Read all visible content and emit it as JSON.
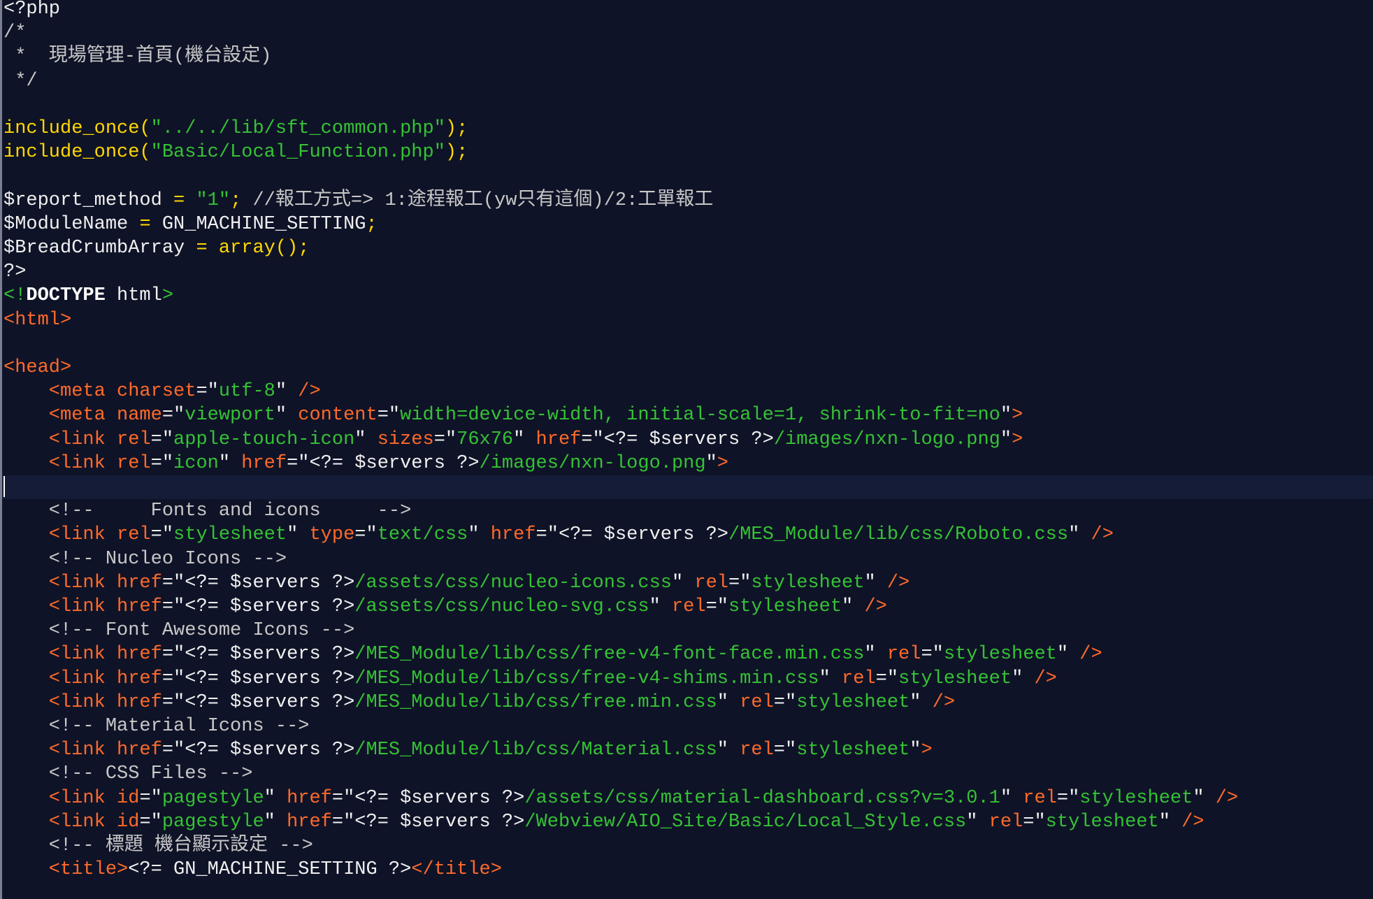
{
  "lines": [
    [
      [
        "<?php",
        "fg"
      ]
    ],
    [
      [
        "/*",
        "comment"
      ]
    ],
    [
      [
        " *  現場管理-首頁(機台設定)",
        "comment"
      ]
    ],
    [
      [
        " */",
        "comment"
      ]
    ],
    [],
    [
      [
        "include_once(",
        "func"
      ],
      [
        "\"../../lib/sft_common.php\"",
        "str"
      ],
      [
        ");",
        "func"
      ]
    ],
    [
      [
        "include_once(",
        "func"
      ],
      [
        "\"Basic/Local_Function.php\"",
        "str"
      ],
      [
        ");",
        "func"
      ]
    ],
    [],
    [
      [
        "$report_method ",
        "fg"
      ],
      [
        "= ",
        "op"
      ],
      [
        "\"1\"",
        "str"
      ],
      [
        "; ",
        "op"
      ],
      [
        "//報工方式=> 1:途程報工(yw只有這個)/2:工單報工",
        "comment"
      ]
    ],
    [
      [
        "$ModuleName ",
        "fg"
      ],
      [
        "= ",
        "op"
      ],
      [
        "GN_MACHINE_SETTING",
        "fg"
      ],
      [
        ";",
        "op"
      ]
    ],
    [
      [
        "$BreadCrumbArray ",
        "fg"
      ],
      [
        "= ",
        "op"
      ],
      [
        "array();",
        "func"
      ]
    ],
    [
      [
        "?>",
        "fg"
      ]
    ],
    [
      [
        "<!",
        "decl"
      ],
      [
        "DOCTYPE",
        "doctype"
      ],
      [
        " html",
        "fg"
      ],
      [
        ">",
        "decl"
      ]
    ],
    [
      [
        "<html>",
        "tag"
      ]
    ],
    [],
    [
      [
        "<head>",
        "tag"
      ]
    ],
    [
      [
        "    <meta ",
        "tag"
      ],
      [
        "charset",
        "attr"
      ],
      [
        "=\"",
        "quote"
      ],
      [
        "utf-8",
        "val"
      ],
      [
        "\" ",
        "quote"
      ],
      [
        "/>",
        "tag"
      ]
    ],
    [
      [
        "    <meta ",
        "tag"
      ],
      [
        "name",
        "attr"
      ],
      [
        "=\"",
        "quote"
      ],
      [
        "viewport",
        "val"
      ],
      [
        "\" ",
        "quote"
      ],
      [
        "content",
        "attr"
      ],
      [
        "=\"",
        "quote"
      ],
      [
        "width=device-width, initial-scale=1, shrink-to-fit=no",
        "val"
      ],
      [
        "\"",
        "quote"
      ],
      [
        ">",
        "tag"
      ]
    ],
    [
      [
        "    <link ",
        "tag"
      ],
      [
        "rel",
        "attr"
      ],
      [
        "=\"",
        "quote"
      ],
      [
        "apple-touch-icon",
        "val"
      ],
      [
        "\" ",
        "quote"
      ],
      [
        "sizes",
        "attr"
      ],
      [
        "=\"",
        "quote"
      ],
      [
        "76x76",
        "val"
      ],
      [
        "\" ",
        "quote"
      ],
      [
        "href",
        "attr"
      ],
      [
        "=\"<?= $servers ?>",
        "quote"
      ],
      [
        "/images/nxn-logo.png",
        "val"
      ],
      [
        "\"",
        "quote"
      ],
      [
        ">",
        "tag"
      ]
    ],
    [
      [
        "    <link ",
        "tag"
      ],
      [
        "rel",
        "attr"
      ],
      [
        "=\"",
        "quote"
      ],
      [
        "icon",
        "val"
      ],
      [
        "\" ",
        "quote"
      ],
      [
        "href",
        "attr"
      ],
      [
        "=\"<?= $servers ?>",
        "quote"
      ],
      [
        "/images/nxn-logo.png",
        "val"
      ],
      [
        "\"",
        "quote"
      ],
      [
        ">",
        "tag"
      ]
    ],
    [],
    [
      [
        "    <!--     Fonts and icons     -->",
        "comment"
      ]
    ],
    [
      [
        "    <link ",
        "tag"
      ],
      [
        "rel",
        "attr"
      ],
      [
        "=\"",
        "quote"
      ],
      [
        "stylesheet",
        "val"
      ],
      [
        "\" ",
        "quote"
      ],
      [
        "type",
        "attr"
      ],
      [
        "=\"",
        "quote"
      ],
      [
        "text/css",
        "val"
      ],
      [
        "\" ",
        "quote"
      ],
      [
        "href",
        "attr"
      ],
      [
        "=\"<?= $servers ?>",
        "quote"
      ],
      [
        "/MES_Module/lib/css/Roboto.css",
        "val"
      ],
      [
        "\" ",
        "quote"
      ],
      [
        "/>",
        "tag"
      ]
    ],
    [
      [
        "    <!-- Nucleo Icons -->",
        "comment"
      ]
    ],
    [
      [
        "    <link ",
        "tag"
      ],
      [
        "href",
        "attr"
      ],
      [
        "=\"<?= $servers ?>",
        "quote"
      ],
      [
        "/assets/css/nucleo-icons.css",
        "val"
      ],
      [
        "\" ",
        "quote"
      ],
      [
        "rel",
        "attr"
      ],
      [
        "=\"",
        "quote"
      ],
      [
        "stylesheet",
        "val"
      ],
      [
        "\" ",
        "quote"
      ],
      [
        "/>",
        "tag"
      ]
    ],
    [
      [
        "    <link ",
        "tag"
      ],
      [
        "href",
        "attr"
      ],
      [
        "=\"<?= $servers ?>",
        "quote"
      ],
      [
        "/assets/css/nucleo-svg.css",
        "val"
      ],
      [
        "\" ",
        "quote"
      ],
      [
        "rel",
        "attr"
      ],
      [
        "=\"",
        "quote"
      ],
      [
        "stylesheet",
        "val"
      ],
      [
        "\" ",
        "quote"
      ],
      [
        "/>",
        "tag"
      ]
    ],
    [
      [
        "    <!-- Font Awesome Icons -->",
        "comment"
      ]
    ],
    [
      [
        "    <link ",
        "tag"
      ],
      [
        "href",
        "attr"
      ],
      [
        "=\"<?= $servers ?>",
        "quote"
      ],
      [
        "/MES_Module/lib/css/free-v4-font-face.min.css",
        "val"
      ],
      [
        "\" ",
        "quote"
      ],
      [
        "rel",
        "attr"
      ],
      [
        "=\"",
        "quote"
      ],
      [
        "stylesheet",
        "val"
      ],
      [
        "\" ",
        "quote"
      ],
      [
        "/>",
        "tag"
      ]
    ],
    [
      [
        "    <link ",
        "tag"
      ],
      [
        "href",
        "attr"
      ],
      [
        "=\"<?= $servers ?>",
        "quote"
      ],
      [
        "/MES_Module/lib/css/free-v4-shims.min.css",
        "val"
      ],
      [
        "\" ",
        "quote"
      ],
      [
        "rel",
        "attr"
      ],
      [
        "=\"",
        "quote"
      ],
      [
        "stylesheet",
        "val"
      ],
      [
        "\" ",
        "quote"
      ],
      [
        "/>",
        "tag"
      ]
    ],
    [
      [
        "    <link ",
        "tag"
      ],
      [
        "href",
        "attr"
      ],
      [
        "=\"<?= $servers ?>",
        "quote"
      ],
      [
        "/MES_Module/lib/css/free.min.css",
        "val"
      ],
      [
        "\" ",
        "quote"
      ],
      [
        "rel",
        "attr"
      ],
      [
        "=\"",
        "quote"
      ],
      [
        "stylesheet",
        "val"
      ],
      [
        "\" ",
        "quote"
      ],
      [
        "/>",
        "tag"
      ]
    ],
    [
      [
        "    <!-- Material Icons -->",
        "comment"
      ]
    ],
    [
      [
        "    <link ",
        "tag"
      ],
      [
        "href",
        "attr"
      ],
      [
        "=\"<?= $servers ?>",
        "quote"
      ],
      [
        "/MES_Module/lib/css/Material.css",
        "val"
      ],
      [
        "\" ",
        "quote"
      ],
      [
        "rel",
        "attr"
      ],
      [
        "=\"",
        "quote"
      ],
      [
        "stylesheet",
        "val"
      ],
      [
        "\"",
        "quote"
      ],
      [
        ">",
        "tag"
      ]
    ],
    [
      [
        "    <!-- CSS Files -->",
        "comment"
      ]
    ],
    [
      [
        "    <link ",
        "tag"
      ],
      [
        "id",
        "attr"
      ],
      [
        "=\"",
        "quote"
      ],
      [
        "pagestyle",
        "val"
      ],
      [
        "\" ",
        "quote"
      ],
      [
        "href",
        "attr"
      ],
      [
        "=\"<?= $servers ?>",
        "quote"
      ],
      [
        "/assets/css/material-dashboard.css?v=3.0.1",
        "val"
      ],
      [
        "\" ",
        "quote"
      ],
      [
        "rel",
        "attr"
      ],
      [
        "=\"",
        "quote"
      ],
      [
        "stylesheet",
        "val"
      ],
      [
        "\" ",
        "quote"
      ],
      [
        "/>",
        "tag"
      ]
    ],
    [
      [
        "    <link ",
        "tag"
      ],
      [
        "id",
        "attr"
      ],
      [
        "=\"",
        "quote"
      ],
      [
        "pagestyle",
        "val"
      ],
      [
        "\" ",
        "quote"
      ],
      [
        "href",
        "attr"
      ],
      [
        "=\"<?= $servers ?>",
        "quote"
      ],
      [
        "/Webview/AIO_Site/Basic/Local_Style.css",
        "val"
      ],
      [
        "\" ",
        "quote"
      ],
      [
        "rel",
        "attr"
      ],
      [
        "=\"",
        "quote"
      ],
      [
        "stylesheet",
        "val"
      ],
      [
        "\" ",
        "quote"
      ],
      [
        "/>",
        "tag"
      ]
    ],
    [
      [
        "    <!-- 標題 機台顯示設定 -->",
        "comment"
      ]
    ],
    [
      [
        "    <title>",
        "tag"
      ],
      [
        "<?= GN_MACHINE_SETTING ?>",
        "fg"
      ],
      [
        "</title>",
        "tag"
      ]
    ]
  ],
  "active_line": 20
}
